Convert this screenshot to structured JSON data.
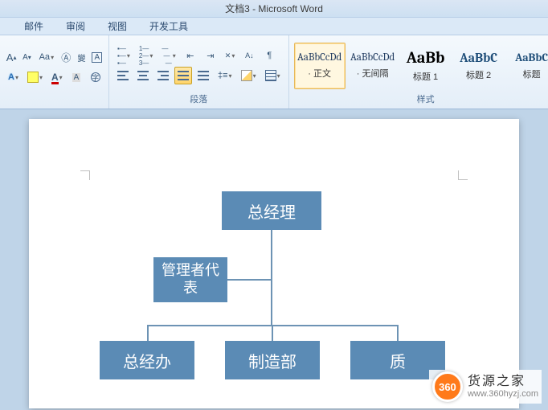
{
  "title": "文档3 - Microsoft Word",
  "tabs": {
    "t1": "邮件",
    "t2": "审阅",
    "t3": "视图",
    "t4": "开发工具"
  },
  "ribbon": {
    "font": {
      "grow": "A",
      "shrink": "A",
      "changecase": "Aa",
      "phonetic": "拼",
      "border": "",
      "a_effects": "A",
      "highlight": "",
      "fontcolor_a": "A",
      "clear": "",
      "enclosed": "字"
    },
    "paragraph": {
      "label": "段落",
      "bullets": "•",
      "numbering": "1",
      "multilevel": "≡",
      "indent_dec": "≤",
      "indent_inc": "≥",
      "sort": "A↓",
      "showmarks": "¶",
      "linespacing": "↕",
      "shading": "",
      "borders": ""
    },
    "styles": {
      "label": "样式",
      "items": [
        {
          "preview": "AaBbCcDd",
          "label": "正文",
          "cls": "",
          "sel": true,
          "dot": true
        },
        {
          "preview": "AaBbCcDd",
          "label": "无间隔",
          "cls": "",
          "sel": false,
          "dot": true
        },
        {
          "preview": "AaBb",
          "label": "标题 1",
          "cls": "big",
          "sel": false,
          "dot": false
        },
        {
          "preview": "AaBbC",
          "label": "标题 2",
          "cls": "h1",
          "sel": false,
          "dot": false
        },
        {
          "preview": "AaBbC",
          "label": "标题",
          "cls": "h2",
          "sel": false,
          "dot": false
        }
      ]
    }
  },
  "chart_data": {
    "type": "orgchart",
    "nodes": {
      "root": "总经理",
      "assistant": "管理者代表",
      "children": [
        "总经办",
        "制造部",
        "质"
      ]
    }
  },
  "watermark": {
    "badge": "360",
    "title": "货源之家",
    "url": "www.360hyzj.com"
  }
}
